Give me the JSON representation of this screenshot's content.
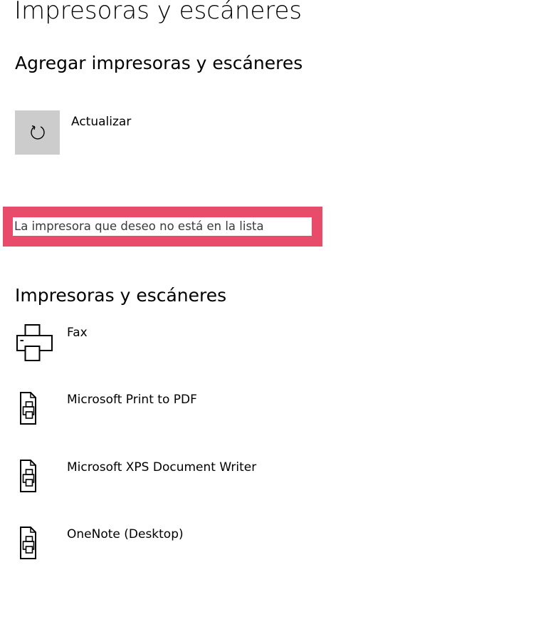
{
  "page": {
    "title": "Impresoras y escáneres"
  },
  "add_section": {
    "title": "Agregar impresoras y escáneres",
    "refresh_label": "Actualizar",
    "refresh_icon": "refresh-icon",
    "missing_printer_link": "La impresora que deseo no está en la lista",
    "highlight_color": "#e84c6a"
  },
  "devices_section": {
    "title": "Impresoras y escáneres",
    "devices": [
      {
        "name": "Fax",
        "icon": "fax-printer-icon"
      },
      {
        "name": "Microsoft Print to PDF",
        "icon": "document-printer-icon"
      },
      {
        "name": "Microsoft XPS Document Writer",
        "icon": "document-printer-icon"
      },
      {
        "name": "OneNote (Desktop)",
        "icon": "document-printer-icon"
      }
    ]
  },
  "colors": {
    "tile_background": "#cccccc",
    "text": "#000000",
    "link_text": "#3a3a3a"
  }
}
